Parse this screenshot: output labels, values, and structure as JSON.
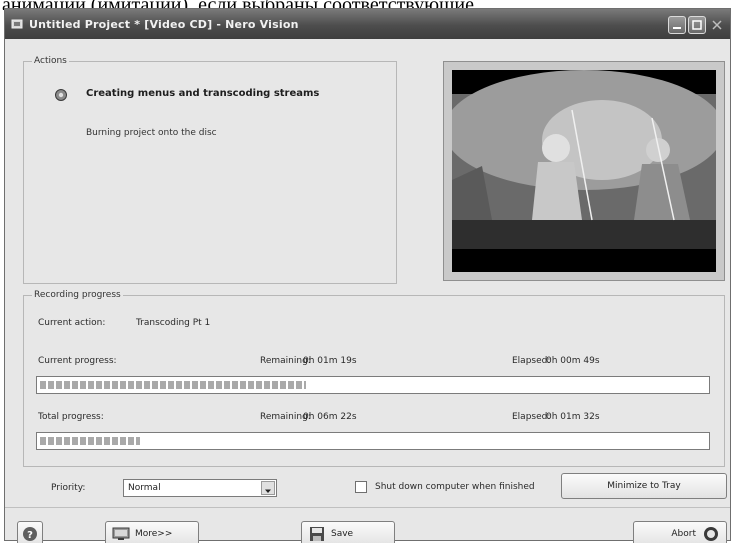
{
  "caption": {
    "text": "анимации (имитации), если выбраны соответствующие"
  },
  "window": {
    "title": "Untitled Project * [Video CD] - Nero Vision"
  },
  "actions": {
    "group_label": "Actions",
    "title": "Creating menus and transcoding streams",
    "subtitle": "Burning project onto the disc"
  },
  "progress": {
    "group_label": "Recording progress",
    "current_action_label": "Current action:",
    "current_action_value": "Transcoding Pt 1",
    "current": {
      "label": "Current progress:",
      "remaining_label": "Remaining:",
      "remaining_value": "0h 01m 19s",
      "elapsed_label": "Elapsed:",
      "elapsed_value": "0h 00m 49s",
      "fraction": 0.4
    },
    "total": {
      "label": "Total progress:",
      "remaining_label": "Remaining:",
      "remaining_value": "0h 06m 22s",
      "elapsed_label": "Elapsed:",
      "elapsed_value": "0h 01m 32s",
      "fraction": 0.15
    }
  },
  "options": {
    "priority_label": "Priority:",
    "priority_value": "Normal",
    "shutdown_label": "Shut down computer when finished",
    "shutdown_checked": false,
    "minimize_label": "Minimize to Tray"
  },
  "footer": {
    "more_label": "More>>",
    "save_label": "Save",
    "abort_label": "Abort"
  },
  "icons": {
    "app": "nero-app-icon",
    "action": "gear-icon",
    "help": "help-icon",
    "more": "monitor-icon",
    "save": "floppy-disk-icon",
    "abort": "abort-icon"
  }
}
